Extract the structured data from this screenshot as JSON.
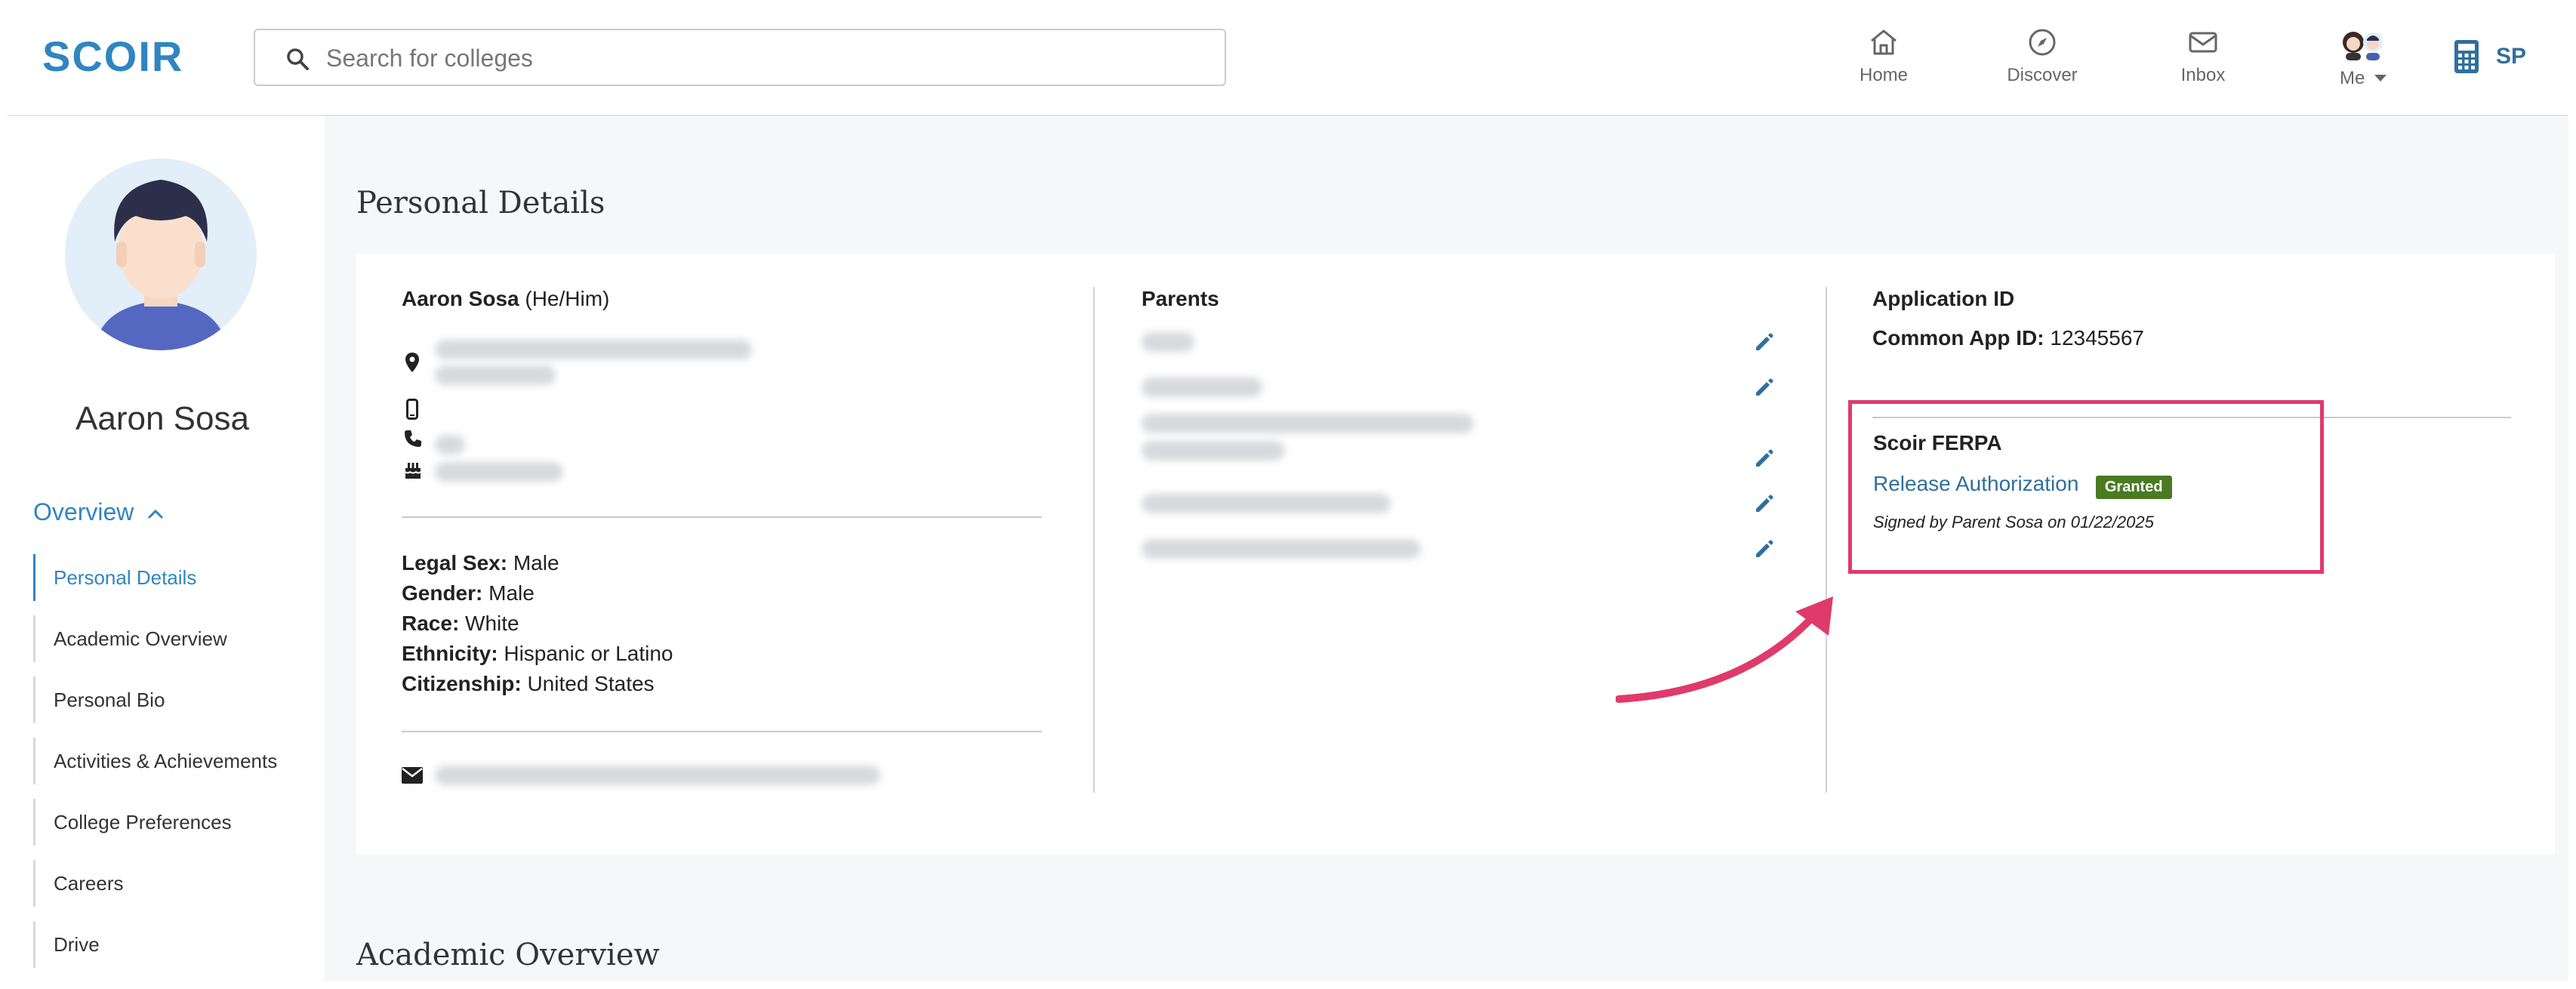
{
  "brand": {
    "logo_text": "SCOIR",
    "accent": "#2f86c0",
    "highlight": "#e03a6c",
    "badge_green": "#4a7a21"
  },
  "search": {
    "placeholder": "Search for colleges",
    "value": ""
  },
  "nav": {
    "home": {
      "label": "Home",
      "icon": "home-icon"
    },
    "discover": {
      "label": "Discover",
      "icon": "compass-icon"
    },
    "inbox": {
      "label": "Inbox",
      "icon": "mail-icon"
    },
    "me": {
      "label": "Me",
      "icon": "avatars-icon"
    },
    "user_initials": "SP"
  },
  "sidebar": {
    "student_name": "Aaron Sosa",
    "overview_label": "Overview",
    "items": [
      {
        "label": "Personal Details",
        "active": true
      },
      {
        "label": "Academic Overview"
      },
      {
        "label": "Personal Bio"
      },
      {
        "label": "Activities & Achievements"
      },
      {
        "label": "College Preferences"
      },
      {
        "label": "Careers"
      },
      {
        "label": "Drive"
      }
    ]
  },
  "page": {
    "title": "Personal Details",
    "next_section_title": "Academic Overview"
  },
  "student": {
    "name": "Aaron Sosa",
    "pronouns": "(He/Him)",
    "legal_sex_label": "Legal Sex:",
    "legal_sex": "Male",
    "gender_label": "Gender:",
    "gender": "Male",
    "race_label": "Race:",
    "race": "White",
    "ethnicity_label": "Ethnicity:",
    "ethnicity": "Hispanic or Latino",
    "citizenship_label": "Citizenship:",
    "citizenship": "United States"
  },
  "parents": {
    "heading": "Parents"
  },
  "application": {
    "heading": "Application ID",
    "common_app_label": "Common App ID:",
    "common_app_id": "12345567"
  },
  "ferpa": {
    "heading": "Scoir FERPA",
    "link_label": "Release Authorization",
    "status": "Granted",
    "signed_text": "Signed by Parent Sosa on 01/22/2025"
  }
}
